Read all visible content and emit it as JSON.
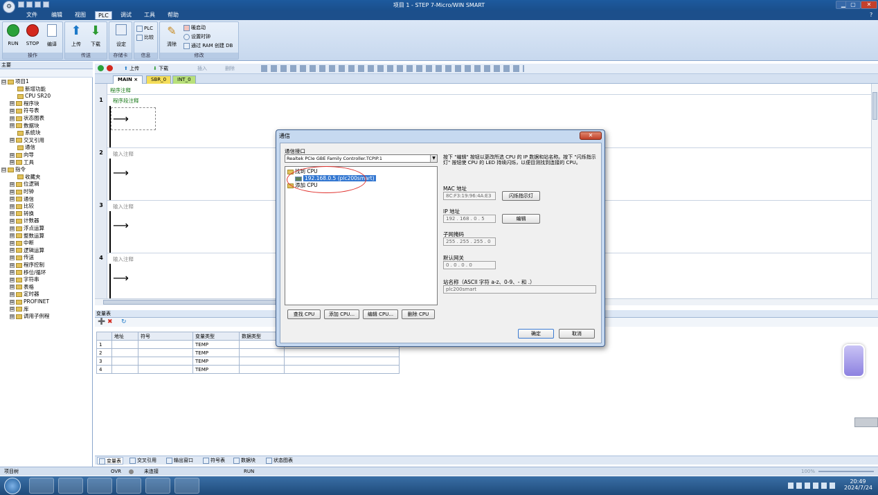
{
  "window": {
    "title": "项目 1 - STEP 7-Micro/WIN SMART",
    "help_glyph": "?"
  },
  "menu": [
    "文件",
    "编辑",
    "视图",
    "PLC",
    "调试",
    "工具",
    "帮助"
  ],
  "menu_active": "PLC",
  "ribbon": {
    "run": "RUN",
    "stop": "STOP",
    "compile": "编译",
    "upload": "上传",
    "download": "下载",
    "settings": "设定",
    "plc_info": "PLC",
    "compare": "比较",
    "clear": "清除",
    "warm_start": "暖启动",
    "set_clock": "设置时钟",
    "ram_create_db": "通过 RAM 创建 DB",
    "groups": [
      "操作",
      "传送",
      "存储卡",
      "信息",
      "修改"
    ]
  },
  "left_pane": {
    "title": "主要",
    "tree": [
      {
        "label": "项目1",
        "indent": 0,
        "toggle": "⊟"
      },
      {
        "label": "新增功能",
        "indent": 1,
        "toggle": ""
      },
      {
        "label": "CPU SR20",
        "indent": 1,
        "toggle": ""
      },
      {
        "label": "程序块",
        "indent": 1,
        "toggle": "⊞"
      },
      {
        "label": "符号表",
        "indent": 1,
        "toggle": "⊞"
      },
      {
        "label": "状态图表",
        "indent": 1,
        "toggle": "⊞"
      },
      {
        "label": "数据块",
        "indent": 1,
        "toggle": "⊞"
      },
      {
        "label": "系统块",
        "indent": 1,
        "toggle": ""
      },
      {
        "label": "交叉引用",
        "indent": 1,
        "toggle": "⊞"
      },
      {
        "label": "通信",
        "indent": 1,
        "toggle": ""
      },
      {
        "label": "向导",
        "indent": 1,
        "toggle": "⊞"
      },
      {
        "label": "工具",
        "indent": 1,
        "toggle": "⊞"
      },
      {
        "label": "指令",
        "indent": 0,
        "toggle": "⊟"
      },
      {
        "label": "收藏夹",
        "indent": 1,
        "toggle": ""
      },
      {
        "label": "位逻辑",
        "indent": 1,
        "toggle": "⊞"
      },
      {
        "label": "时钟",
        "indent": 1,
        "toggle": "⊞"
      },
      {
        "label": "通信",
        "indent": 1,
        "toggle": "⊞"
      },
      {
        "label": "比较",
        "indent": 1,
        "toggle": "⊞"
      },
      {
        "label": "转换",
        "indent": 1,
        "toggle": "⊞"
      },
      {
        "label": "计数器",
        "indent": 1,
        "toggle": "⊞"
      },
      {
        "label": "浮点运算",
        "indent": 1,
        "toggle": "⊞"
      },
      {
        "label": "整数运算",
        "indent": 1,
        "toggle": "⊞"
      },
      {
        "label": "中断",
        "indent": 1,
        "toggle": "⊞"
      },
      {
        "label": "逻辑运算",
        "indent": 1,
        "toggle": "⊞"
      },
      {
        "label": "传送",
        "indent": 1,
        "toggle": "⊞"
      },
      {
        "label": "程序控制",
        "indent": 1,
        "toggle": "⊞"
      },
      {
        "label": "移位/循环",
        "indent": 1,
        "toggle": "⊞"
      },
      {
        "label": "字符串",
        "indent": 1,
        "toggle": "⊞"
      },
      {
        "label": "表格",
        "indent": 1,
        "toggle": "⊞"
      },
      {
        "label": "定时器",
        "indent": 1,
        "toggle": "⊞"
      },
      {
        "label": "PROFINET",
        "indent": 1,
        "toggle": "⊞"
      },
      {
        "label": "库",
        "indent": 1,
        "toggle": "⊞"
      },
      {
        "label": "调用子例程",
        "indent": 1,
        "toggle": "⊞"
      }
    ]
  },
  "editor_toolbar": {
    "upload": "上传",
    "download": "下载",
    "insert": "插入",
    "delete": "删除"
  },
  "editor_tabs": [
    "MAIN",
    "SBR_0",
    "INT_0"
  ],
  "editor": {
    "program_comment": "程序注释",
    "networks": [
      {
        "num": "1",
        "comment": "程序段注释"
      },
      {
        "num": "2",
        "comment": "输入注释"
      },
      {
        "num": "3",
        "comment": "输入注释"
      },
      {
        "num": "4",
        "comment": "输入注释"
      }
    ]
  },
  "var_table": {
    "title": "变量表",
    "columns": [
      "",
      "地址",
      "符号",
      "变量类型",
      "数据类型",
      ""
    ],
    "rows": [
      {
        "n": "1",
        "type": "TEMP"
      },
      {
        "n": "2",
        "type": "TEMP"
      },
      {
        "n": "3",
        "type": "TEMP"
      },
      {
        "n": "4",
        "type": "TEMP"
      }
    ]
  },
  "bottom_tabs": [
    "变量表",
    "交叉引用",
    "输出窗口",
    "符号表",
    "数据块",
    "状态图表"
  ],
  "status": {
    "left": "项目树",
    "ovr": "OVR",
    "conn": "未连接",
    "mode": "RUN",
    "zoom": "100%"
  },
  "taskbar": {
    "time": "20:49",
    "date": "2024/7/24"
  },
  "dialog": {
    "title": "通信",
    "iface_label": "通信接口",
    "iface_value": "Realtek PCIe GBE Family Controller.TCPIP.1",
    "tree_found": "找到 CPU",
    "tree_item": "192.168.0.5 (plc200smart)",
    "tree_add": "添加 CPU",
    "help_text": "按下 \"编辑\" 按钮以更改所选 CPU 的 IP 数据和站名称。按下 \"闪烁指示灯\" 按钮使 CPU 的 LED 持续闪烁，以便目测找到连接的 CPU。",
    "mac_label": "MAC 地址",
    "mac_value": "8C:F3:19:96:4A:E3",
    "blink_btn": "闪烁指示灯",
    "ip_label": "IP 地址",
    "ip_value": "192 . 168 . 0 . 5",
    "edit_btn": "编辑",
    "mask_label": "子网掩码",
    "mask_value": "255 . 255 . 255 . 0",
    "gw_label": "默认网关",
    "gw_value": "0 . 0 . 0 . 0",
    "station_label": "站名称（ASCII 字符 a-z、0-9、- 和 .）",
    "station_value": "plc200smart",
    "find_btn": "查找 CPU",
    "add_btn": "添加 CPU...",
    "editcpu_btn": "编辑 CPU...",
    "del_btn": "删除 CPU",
    "ok_btn": "确定",
    "cancel_btn": "取消"
  }
}
